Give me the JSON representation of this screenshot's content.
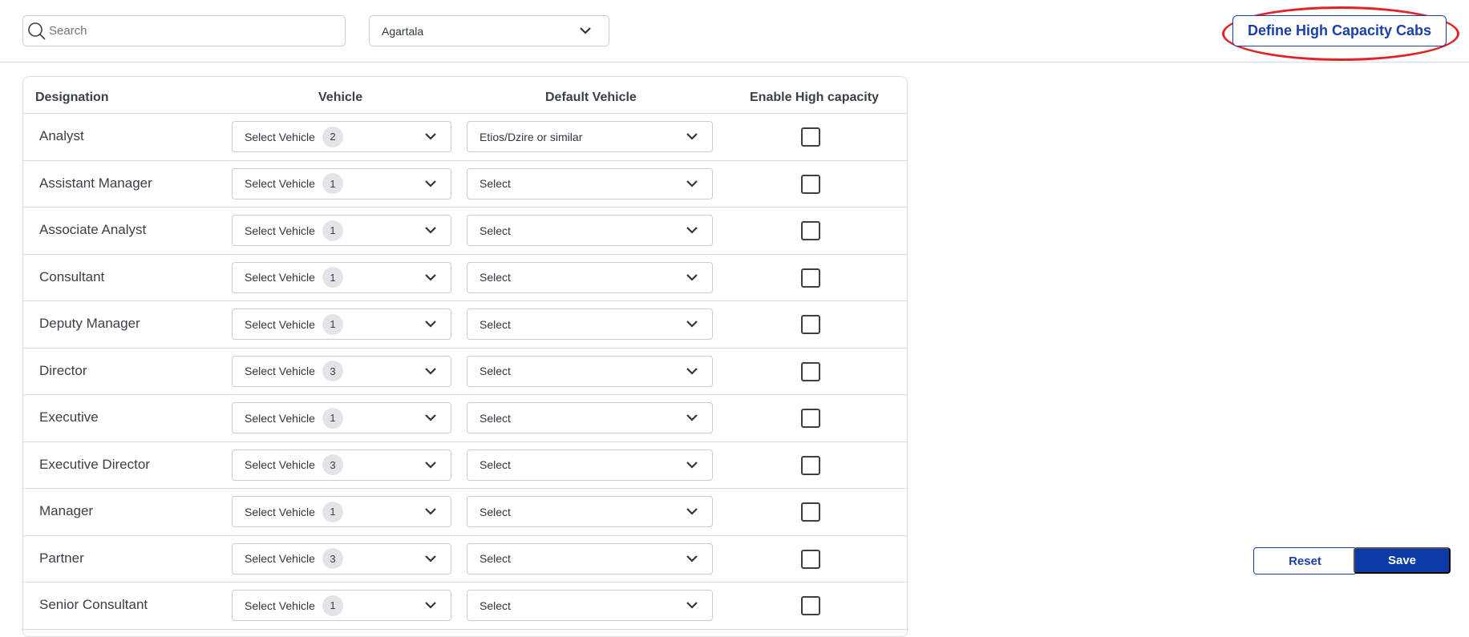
{
  "search": {
    "placeholder": "Search"
  },
  "city": {
    "selected": "Agartala"
  },
  "define_button": {
    "label": "Define High Capacity Cabs"
  },
  "table": {
    "headers": {
      "designation": "Designation",
      "vehicle": "Vehicle",
      "default_vehicle": "Default Vehicle",
      "enable_high_capacity": "Enable High capacity"
    },
    "rows": [
      {
        "designation": "Analyst",
        "vehicle_label": "Select Vehicle",
        "vehicle_count": "2",
        "default_vehicle": "Etios/Dzire or similar",
        "high_capacity": false
      },
      {
        "designation": "Assistant Manager",
        "vehicle_label": "Select Vehicle",
        "vehicle_count": "1",
        "default_vehicle": "Select",
        "high_capacity": false
      },
      {
        "designation": "Associate Analyst",
        "vehicle_label": "Select Vehicle",
        "vehicle_count": "1",
        "default_vehicle": "Select",
        "high_capacity": false
      },
      {
        "designation": "Consultant",
        "vehicle_label": "Select Vehicle",
        "vehicle_count": "1",
        "default_vehicle": "Select",
        "high_capacity": false
      },
      {
        "designation": "Deputy Manager",
        "vehicle_label": "Select Vehicle",
        "vehicle_count": "1",
        "default_vehicle": "Select",
        "high_capacity": false
      },
      {
        "designation": "Director",
        "vehicle_label": "Select Vehicle",
        "vehicle_count": "3",
        "default_vehicle": "Select",
        "high_capacity": false
      },
      {
        "designation": "Executive",
        "vehicle_label": "Select Vehicle",
        "vehicle_count": "1",
        "default_vehicle": "Select",
        "high_capacity": false
      },
      {
        "designation": "Executive Director",
        "vehicle_label": "Select Vehicle",
        "vehicle_count": "3",
        "default_vehicle": "Select",
        "high_capacity": false
      },
      {
        "designation": "Manager",
        "vehicle_label": "Select Vehicle",
        "vehicle_count": "1",
        "default_vehicle": "Select",
        "high_capacity": false
      },
      {
        "designation": "Partner",
        "vehicle_label": "Select Vehicle",
        "vehicle_count": "3",
        "default_vehicle": "Select",
        "high_capacity": false
      },
      {
        "designation": "Senior Consultant",
        "vehicle_label": "Select Vehicle",
        "vehicle_count": "1",
        "default_vehicle": "Select",
        "high_capacity": false
      }
    ]
  },
  "actions": {
    "reset_label": "Reset",
    "save_label": "Save"
  },
  "colors": {
    "accent": "#1a3fa6",
    "save_bg": "#0d3aa8",
    "highlight": "#e02424"
  },
  "icons": {
    "search": "search-icon",
    "dropdown": "chevron-down-icon",
    "checkbox": "checkbox-icon"
  }
}
